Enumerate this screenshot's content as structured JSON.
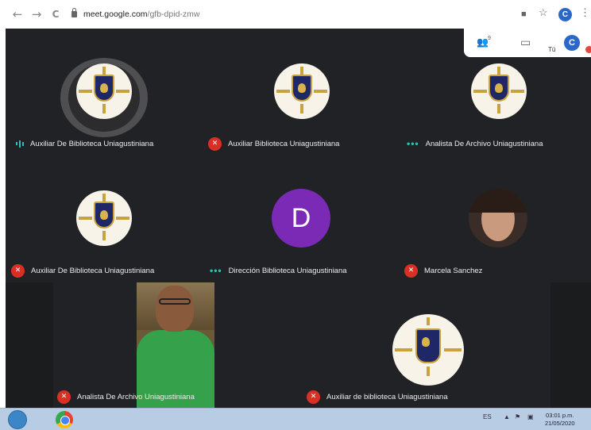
{
  "browser": {
    "back_icon": "←",
    "forward_icon": "→",
    "reload_icon": "C",
    "url_host": "meet.google.com",
    "url_path": "/gfb-dpid-zmw",
    "camera_icon": "■",
    "star_icon": "☆",
    "profile_initial": "C",
    "menu_icon": "⋮"
  },
  "meet_bar": {
    "people_icon": "👥",
    "participant_count": "9",
    "chat_icon": "▭",
    "self_label": "Tú",
    "self_initial": "C"
  },
  "participants": [
    {
      "name": "Auxiliar De Biblioteca Uniagustiniana",
      "status": "speaking"
    },
    {
      "name": "Auxiliar Biblioteca Uniagustiniana",
      "status": "muted"
    },
    {
      "name": "Analista De Archivo Uniagustiniana",
      "status": "dots"
    },
    {
      "name": "Auxiliar De Biblioteca Uniagustiniana",
      "status": "muted"
    },
    {
      "name": "Dirección Biblioteca Uniagustiniana",
      "status": "dots",
      "initial": "D"
    },
    {
      "name": "Marcela Sanchez",
      "status": "muted"
    },
    {
      "name": "Analista De Archivo Uniagustiniana",
      "status": "muted"
    },
    {
      "name": "Auxiliar de biblioteca Uniagustiniana",
      "status": "muted"
    }
  ],
  "taskbar": {
    "language": "ES",
    "time": "03:01 p.m.",
    "date": "21/05/2020"
  },
  "colors": {
    "stage_bg": "#212225",
    "mute_red": "#d93025",
    "indicator_teal": "#26c6b6",
    "avatar_purple": "#7b2ab5"
  }
}
